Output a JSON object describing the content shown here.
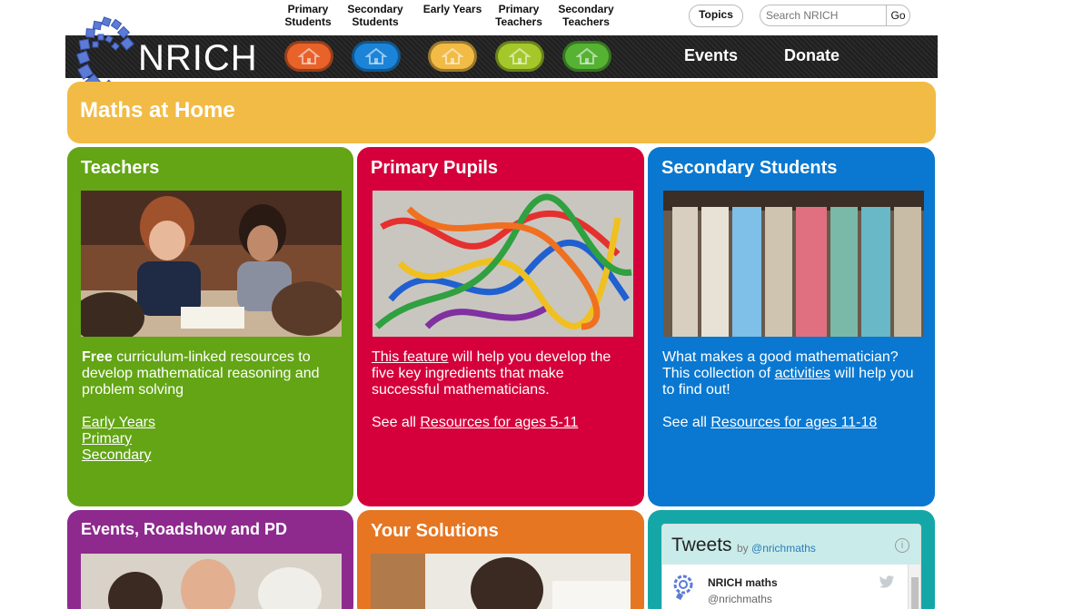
{
  "topnav": {
    "links": [
      {
        "label": "Primary\nStudents"
      },
      {
        "label": "Secondary\nStudents"
      },
      {
        "label": "Early Years"
      },
      {
        "label": "Primary\nTeachers"
      },
      {
        "label": "Secondary\nTeachers"
      }
    ],
    "topics_label": "Topics",
    "search_placeholder": "Search NRICH",
    "go_label": "Go"
  },
  "banner": {
    "logo_text": "NRICH",
    "home_buttons": [
      {
        "icon": "home-icon",
        "color": "#e8622a"
      },
      {
        "icon": "home-icon",
        "color": "#1b84d8"
      },
      {
        "icon": "home-icon",
        "color": "#f2bb45"
      },
      {
        "icon": "home-icon",
        "color": "#a4c82a"
      },
      {
        "icon": "home-icon",
        "color": "#55b233"
      }
    ],
    "events_label": "Events",
    "donate_label": "Donate"
  },
  "main": {
    "title": "Maths at Home"
  },
  "cards": {
    "teachers": {
      "title": "Teachers",
      "color": "#63a515",
      "bold_lead": "Free",
      "text": " curriculum-linked resources to develop mathematical reasoning and problem solving",
      "links": [
        "Early Years",
        "Primary",
        "Secondary"
      ]
    },
    "primary": {
      "title": "Primary Pupils",
      "color": "#d5003b",
      "link_lead": "This feature",
      "text": " will help you develop the five key ingredients that make successful mathematicians.",
      "see_all": "See all ",
      "see_all_link": "Resources for ages 5-11"
    },
    "secondary": {
      "title": "Secondary Students",
      "color": "#0a78d0",
      "text_a": "What makes a good mathematician? This collection of ",
      "link": "activities",
      "text_b": " will help you to find out!",
      "see_all": "See all ",
      "see_all_link": "Resources for ages 11-18"
    },
    "events": {
      "title": "Events, Roadshow and PD",
      "color": "#8e2a8e"
    },
    "solutions": {
      "title": "Your Solutions",
      "color": "#e67622"
    },
    "twitter": {
      "color": "#15a7a7",
      "title": "Tweets",
      "by": "by ",
      "handle": "@nrichmaths",
      "account_name": "NRICH maths",
      "account_handle": "@nrichmaths"
    }
  }
}
